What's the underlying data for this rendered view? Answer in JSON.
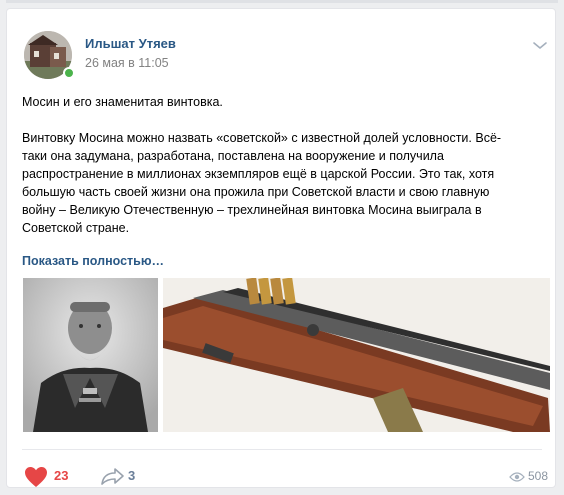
{
  "post": {
    "author": "Ильшат Утяев",
    "date": "26 мая в 11:05",
    "text_title": "Мосин и его знаменитая винтовка.",
    "text_lines": [
      "Винтовку Мосина можно назвать «советской» с известной долей условности. Всё-",
      "таки она задумана, разработана, поставлена на вооружение и получила",
      "распространение в миллионах экземпляров ещё в царской России. Это так, хотя",
      "большую часть своей жизни она прожила при Советской власти и свою главную",
      "войну – Великую Отечественную – трехлинейная винтовка Мосина выиграла в",
      "Советской стране."
    ],
    "show_more": "Показать полностью…",
    "likes": "23",
    "shares": "3",
    "views": "508"
  },
  "icons": {
    "menu": "chevron-down-icon",
    "like": "heart-icon",
    "share": "share-arrow-icon",
    "views": "eye-icon"
  },
  "colors": {
    "link": "#2a5885",
    "like": "#e64646",
    "online": "#4bb34b",
    "muted": "#828282"
  }
}
